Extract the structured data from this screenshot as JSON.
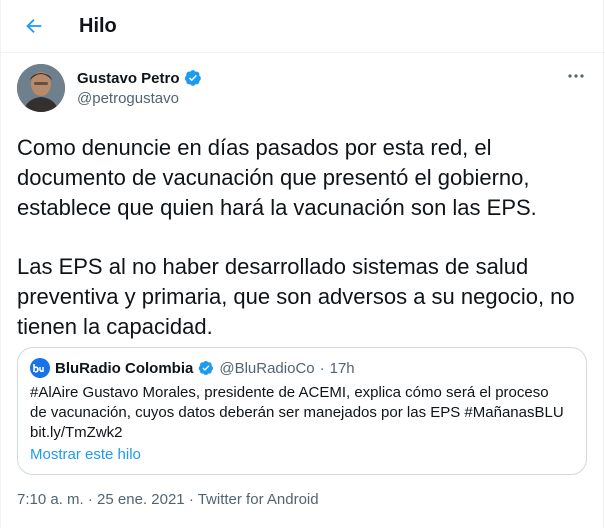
{
  "header": {
    "title": "Hilo",
    "back_icon": "arrow-left-icon"
  },
  "author": {
    "name": "Gustavo Petro",
    "handle": "@petrogustavo",
    "verified_icon": "verified-badge-icon",
    "more_icon": "more-dots-icon"
  },
  "tweet": {
    "lines": [
      "Como denuncie en días pasados por esta red, el",
      "documento de vacunación que presentó el gobierno,",
      "establece que quien hará la vacunación son las EPS.",
      "Las EPS al no haber desarrollado sistemas de salud",
      "preventiva y primaria, que son adversos a su negocio, no",
      "tienen la capacidad."
    ]
  },
  "quote": {
    "name": "BluRadio Colombia",
    "handle": "@BluRadioCo",
    "separator": "·",
    "time": "17h",
    "lines": [
      "#AlAire Gustavo Morales, presidente de ACEMI, explica cómo será el proceso",
      "de vacunación, cuyos datos deberán ser manejados por las EPS #MañanasBLU",
      "bit.ly/TmZwk2"
    ],
    "show_thread": "Mostrar este hilo"
  },
  "meta": {
    "time": "7:10 a. m.",
    "sep1": "·",
    "date": "25 ene. 2021",
    "sep2": "·",
    "source": "Twitter for Android"
  },
  "colors": {
    "accent": "#1d9bf0",
    "text": "#0f1419",
    "secondary": "#536471",
    "border": "#cfd9de"
  }
}
